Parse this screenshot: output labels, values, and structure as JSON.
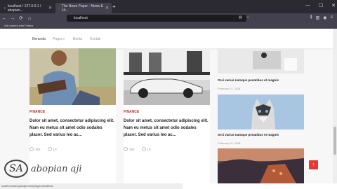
{
  "browser": {
    "tab1": "localhost / 127.0.0.1 / abopian...",
    "tab2": "The News Paper - News & Lif...",
    "new_tab": "+",
    "url": "localhost",
    "bookmark": "Get started with Firefox"
  },
  "nav": {
    "items": [
      "Beranda",
      "Pages",
      "Berita",
      "Kontak"
    ]
  },
  "cards": [
    {
      "category": "FINANCE",
      "title": "Dolor sit amet, consectetur adipiscing elit. Nam eu metus sit amet odio sodales placer. Sed varius leo ac...",
      "likes": "392",
      "comments": "10"
    },
    {
      "category": "FINANCE",
      "title": "Dolor sit amet, consectetur adipiscing elit. Nam eu metus sit amet odio sodales placer. Sed varius leo ac...",
      "likes": "392",
      "comments": "10"
    }
  ],
  "sidebar": [
    {
      "title": "Orci varius natoque penatibus et magnis",
      "date": "February 11, 2018"
    },
    {
      "title": "Orci varius natoque penatibus et magnis",
      "date": "February 11, 2018"
    }
  ],
  "status_url": "localhost/abopianaji/news/pages/#sidebar",
  "watermark": "abopian aji",
  "back_to_top": "↑",
  "colors": {
    "accent": "#c9302c",
    "browser_dark": "#2b2a33"
  }
}
